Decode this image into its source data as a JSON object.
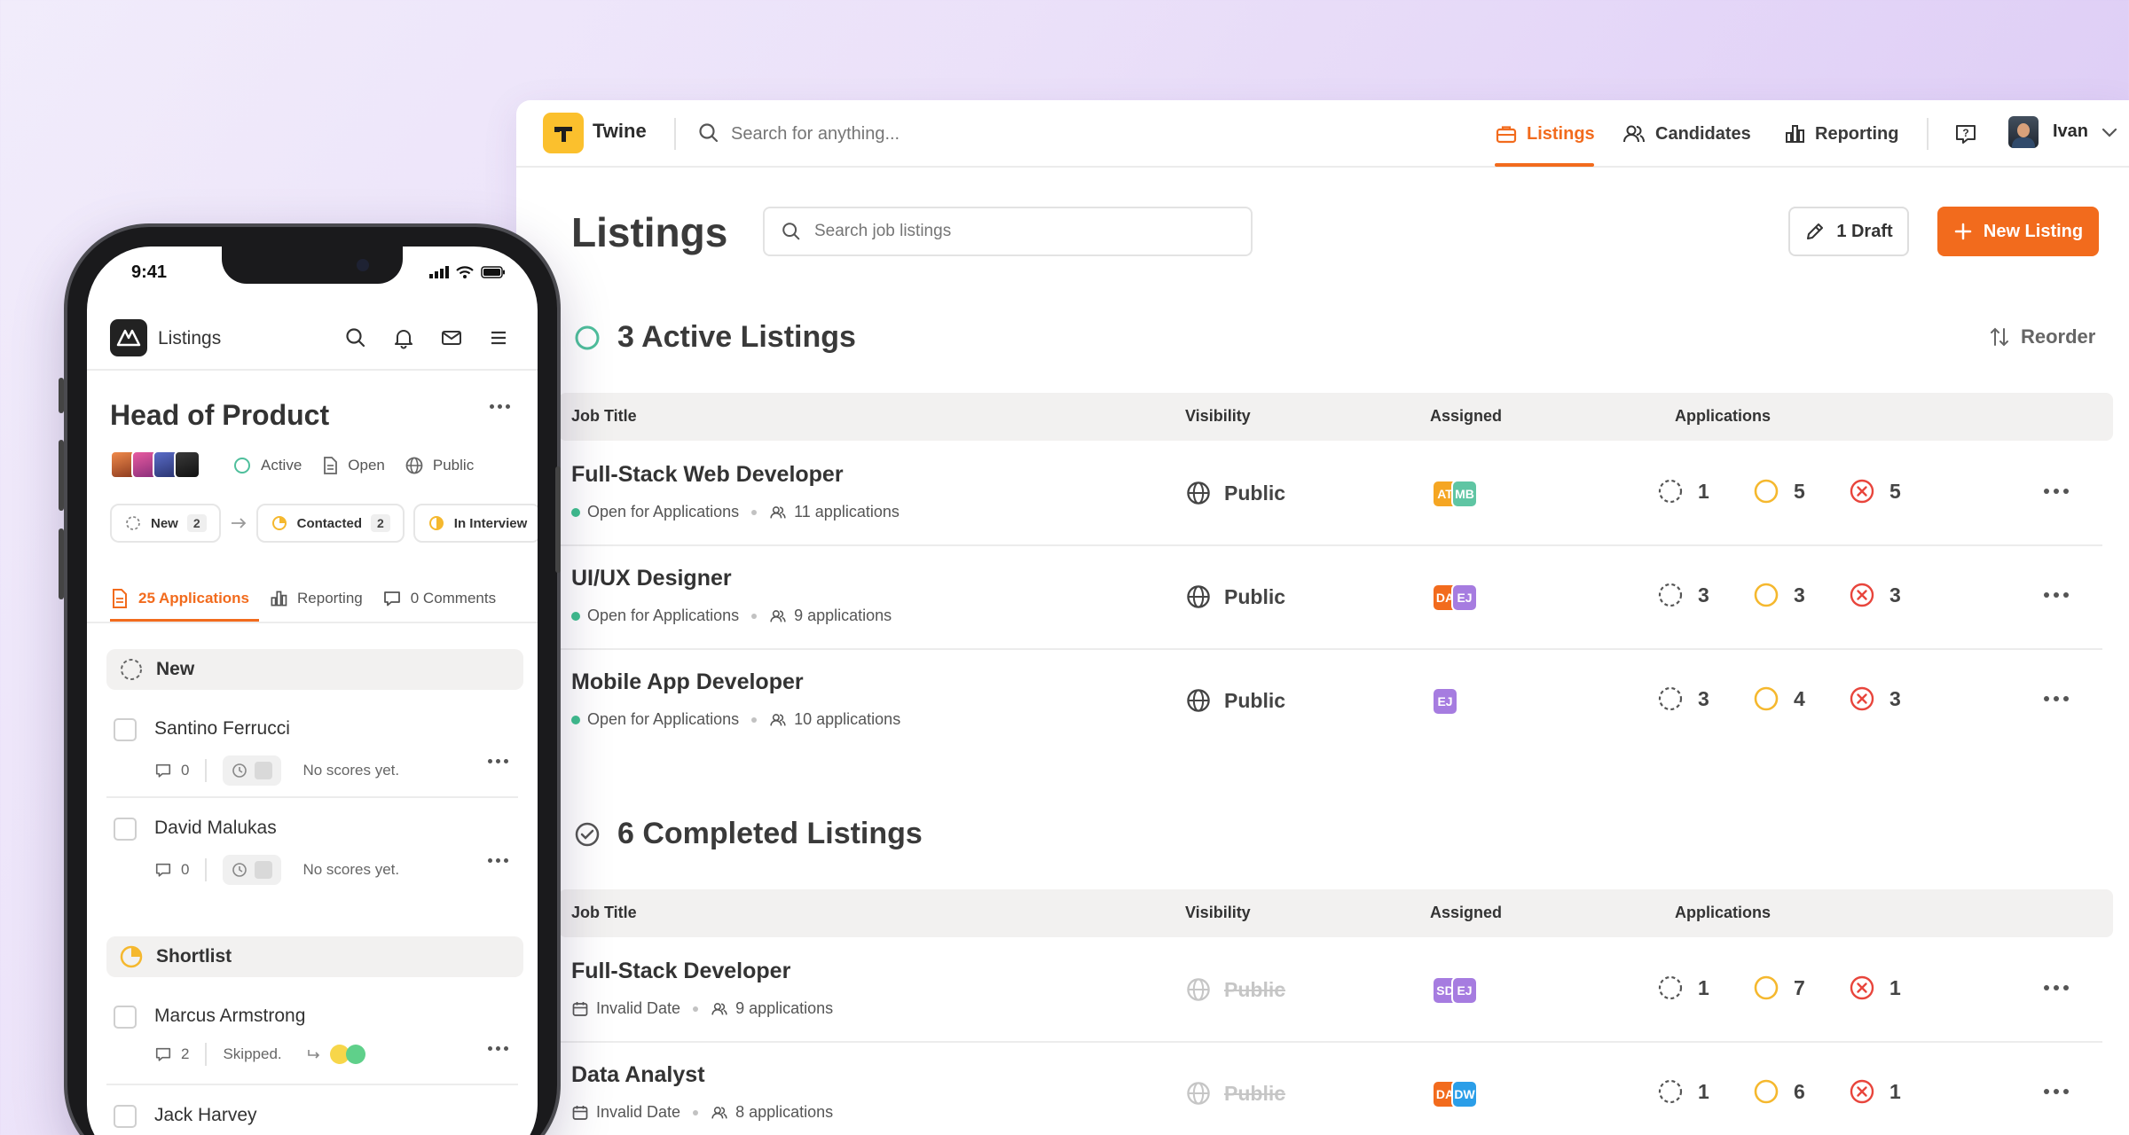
{
  "desktop": {
    "brand": "Twine",
    "search_placeholder": "Search for anything...",
    "nav": [
      {
        "label": "Listings",
        "active": true
      },
      {
        "label": "Candidates",
        "active": false
      },
      {
        "label": "Reporting",
        "active": false
      }
    ],
    "user_name": "Ivan",
    "page_title": "Listings",
    "listing_search_placeholder": "Search job listings",
    "draft_button": "1 Draft",
    "new_listing_button": "New Listing",
    "reorder": "Reorder",
    "columns": {
      "job_title": "Job Title",
      "visibility": "Visibility",
      "assigned": "Assigned",
      "applications": "Applications"
    },
    "active": {
      "title": "3 Active Listings",
      "rows": [
        {
          "title": "Full-Stack Web Developer",
          "status": "Open for Applications",
          "applications": "11 applications",
          "visibility": "Public",
          "assignees": [
            {
              "initials": "AT",
              "color": "#f5a623"
            },
            {
              "initials": "MB",
              "color": "#5fc5a3"
            }
          ],
          "new": "1",
          "progress": "5",
          "rejected": "5"
        },
        {
          "title": "UI/UX Designer",
          "status": "Open for Applications",
          "applications": "9 applications",
          "visibility": "Public",
          "assignees": [
            {
              "initials": "DA",
              "color": "#f26b1d"
            },
            {
              "initials": "EJ",
              "color": "#a67ce0"
            }
          ],
          "new": "3",
          "progress": "3",
          "rejected": "3"
        },
        {
          "title": "Mobile App Developer",
          "status": "Open for Applications",
          "applications": "10 applications",
          "visibility": "Public",
          "assignees": [
            {
              "initials": "EJ",
              "color": "#a67ce0"
            }
          ],
          "new": "3",
          "progress": "4",
          "rejected": "3"
        }
      ]
    },
    "completed": {
      "title": "6 Completed Listings",
      "rows": [
        {
          "title": "Full-Stack Developer",
          "date": "Invalid Date",
          "applications": "9 applications",
          "visibility": "Public",
          "assignees": [
            {
              "initials": "SD",
              "color": "#a67ce0"
            },
            {
              "initials": "EJ",
              "color": "#a67ce0"
            }
          ],
          "new": "1",
          "progress": "7",
          "rejected": "1"
        },
        {
          "title": "Data Analyst",
          "date": "Invalid Date",
          "applications": "8 applications",
          "visibility": "Public",
          "assignees": [
            {
              "initials": "DA",
              "color": "#f26b1d"
            },
            {
              "initials": "DW",
              "color": "#2b9ee8"
            }
          ],
          "new": "1",
          "progress": "6",
          "rejected": "1"
        }
      ]
    }
  },
  "phone": {
    "time": "9:41",
    "header_title": "Listings",
    "job_title": "Head of Product",
    "tags": [
      "Active",
      "Open",
      "Public"
    ],
    "pipeline": [
      {
        "label": "New",
        "count": "2"
      },
      {
        "label": "Contacted",
        "count": "2"
      },
      {
        "label": "In Interview",
        "count": ""
      }
    ],
    "tabs": [
      "25 Applications",
      "Reporting",
      "0 Comments"
    ],
    "stages": [
      {
        "label": "New"
      },
      {
        "label": "Shortlist"
      }
    ],
    "candidates": [
      {
        "name": "Santino Ferrucci",
        "comments": "0",
        "note": "No scores yet."
      },
      {
        "name": "David Malukas",
        "comments": "0",
        "note": "No scores yet."
      },
      {
        "name": "Marcus Armstrong",
        "comments": "2",
        "note": "Skipped."
      },
      {
        "name": "Jack Harvey",
        "comments": "",
        "note": ""
      }
    ],
    "colors": {
      "accent": "#f26b1d",
      "active_green": "#3fbf8f",
      "progress_yellow": "#f5b82e",
      "reject_red": "#e8453c"
    }
  }
}
